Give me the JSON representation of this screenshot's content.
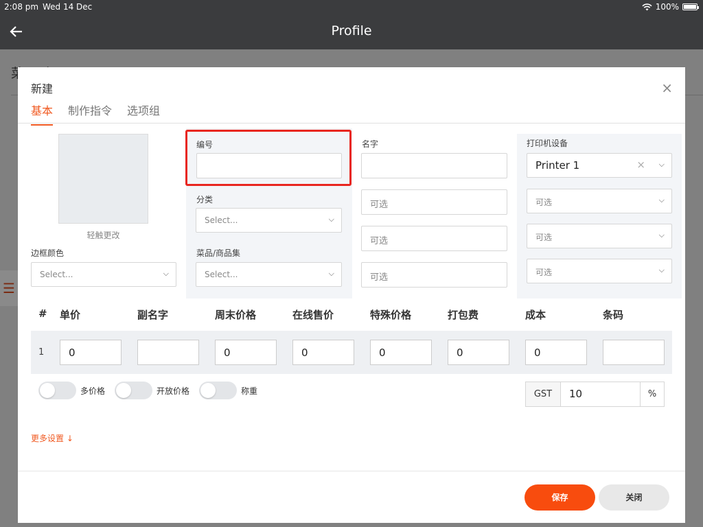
{
  "status": {
    "time": "2:08 pm",
    "date": "Wed 14 Dec",
    "battery": "100%",
    "wifi_icon": "wifi-icon"
  },
  "appbar": {
    "title": "Profile",
    "back_icon": "arrow-left-icon"
  },
  "background": {
    "title": "菜品/商品",
    "menu_icon": "hamburger-icon"
  },
  "modal": {
    "title": "新建",
    "close": "×",
    "tabs": [
      "基本",
      "制作指令",
      "选项组"
    ],
    "active_tab": 0,
    "image_caption": "轻触更改",
    "border_color": {
      "label": "边框颜色",
      "placeholder": "Select..."
    },
    "code": {
      "label": "编号",
      "value": ""
    },
    "category": {
      "label": "分类",
      "placeholder": "Select..."
    },
    "collection": {
      "label": "菜品/商品集",
      "placeholder": "Select..."
    },
    "name": {
      "label": "名字",
      "value": "",
      "optional": [
        "可选",
        "可选",
        "可选"
      ]
    },
    "printer": {
      "label": "打印机设备",
      "selected": "Printer 1",
      "optional": [
        "可选",
        "可选",
        "可选"
      ]
    },
    "price_table": {
      "headers": [
        "#",
        "单价",
        "副名字",
        "周末价格",
        "在线售价",
        "特殊价格",
        "打包费",
        "成本",
        "条码"
      ],
      "rows": [
        {
          "index": "1",
          "values": [
            "0",
            "",
            "0",
            "0",
            "0",
            "0",
            "0",
            ""
          ]
        }
      ]
    },
    "toggles": [
      {
        "label": "多价格",
        "on": false
      },
      {
        "label": "开放价格",
        "on": false
      },
      {
        "label": "称重",
        "on": false
      }
    ],
    "gst": {
      "label": "GST",
      "value": "10",
      "unit": "%"
    },
    "more_settings": "更多设置 ↓",
    "buttons": {
      "save": "保存",
      "close": "关闭"
    }
  }
}
